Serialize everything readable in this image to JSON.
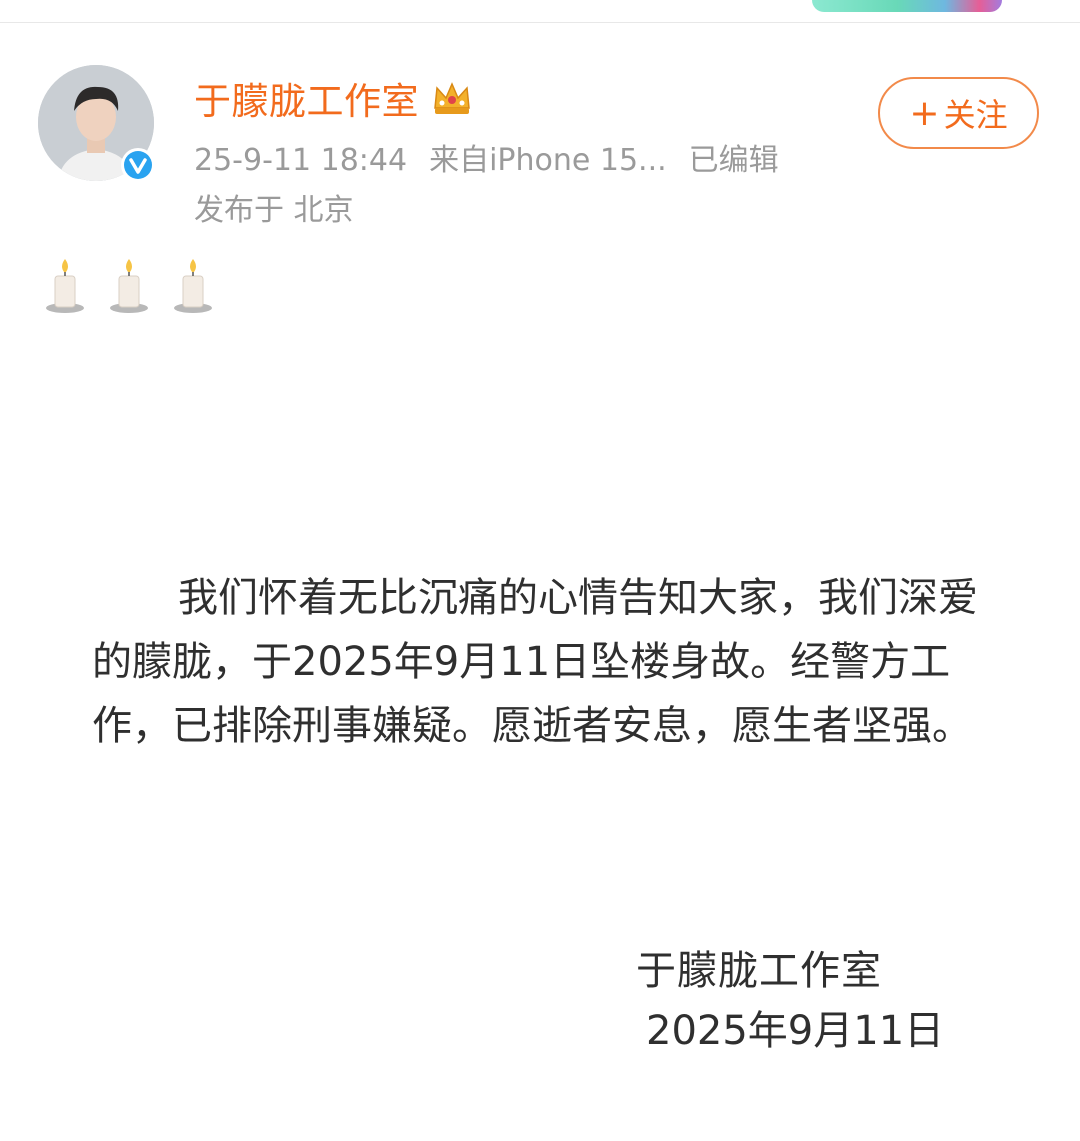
{
  "post": {
    "author": "于朦胧工作室",
    "timestamp": "25-9-11 18:44",
    "source": "来自iPhone 15...",
    "edited": "已编辑",
    "location": "发布于 北京",
    "follow_label": "关注",
    "follow_plus": "+",
    "emoji_icons": [
      "candle-icon",
      "candle-icon",
      "candle-icon"
    ]
  },
  "notice": {
    "body": "我们怀着无比沉痛的心情告知大家，我们深爱的朦胧，于2025年9月11日坠楼身故。经警方工作，已排除刑事嫌疑。愿逝者安息，愿生者坚强。",
    "signature": "于朦胧工作室",
    "date": "2025年9月11日"
  },
  "colors": {
    "accent": "#f26b1d",
    "meta_text": "#9a9a9a",
    "body_text": "#2f2f2f",
    "verify_blue": "#2aa3f0"
  }
}
